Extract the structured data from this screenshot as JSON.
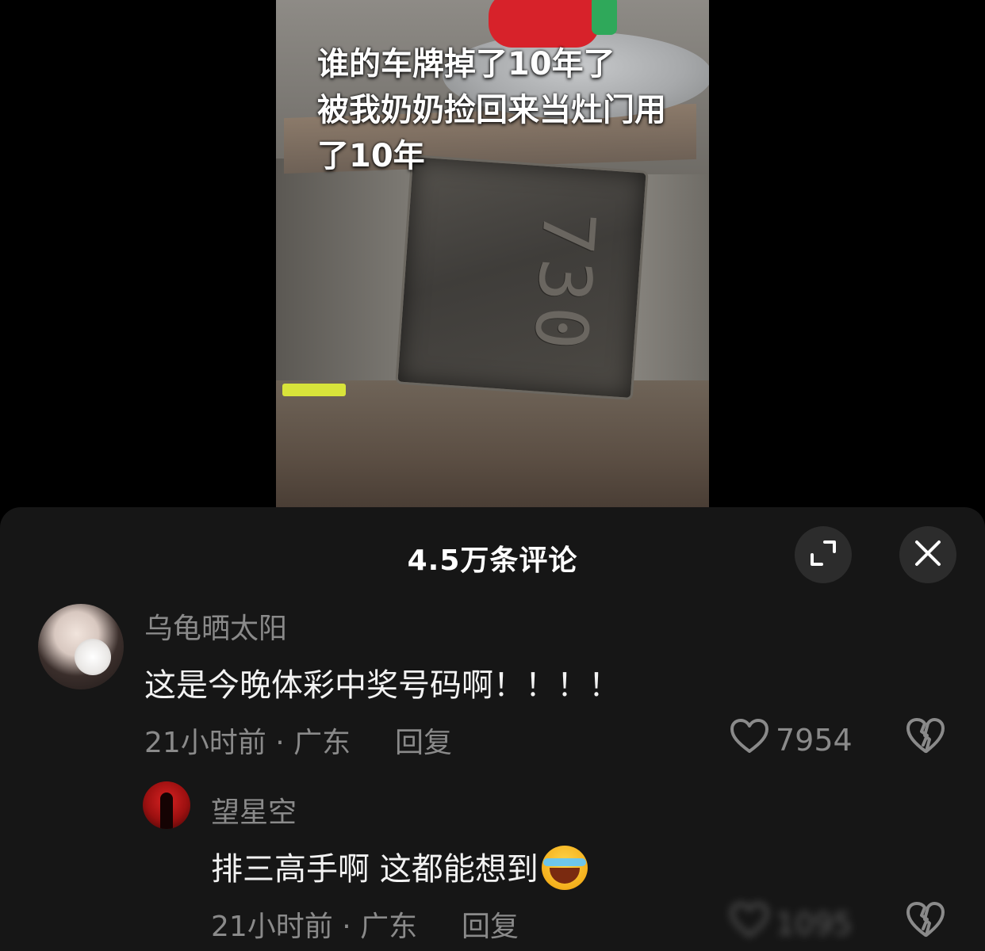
{
  "video": {
    "caption_lines": [
      "谁的车牌掉了10年了",
      "被我奶奶捡回来当灶门用",
      "了10年"
    ],
    "plate_text": "730"
  },
  "comments_sheet": {
    "title": "4.5万条评论",
    "expand_icon": "expand-icon",
    "close_icon": "close-icon"
  },
  "comments": [
    {
      "username": "乌龟晒太阳",
      "text": "这是今晚体彩中奖号码啊！！！！",
      "meta": "21小时前 · 广东",
      "reply_label": "回复",
      "likes": "7954"
    },
    {
      "username": "望星空",
      "text": "排三高手啊 这都能想到",
      "emoji": "crying-laughing-emoji",
      "meta": "21小时前 · 广东",
      "reply_label": "回复",
      "likes": "1095"
    }
  ],
  "colors": {
    "sheet_bg": "#161616",
    "muted_text": "#8a8a8a",
    "button_bg": "#2c2c2c"
  }
}
